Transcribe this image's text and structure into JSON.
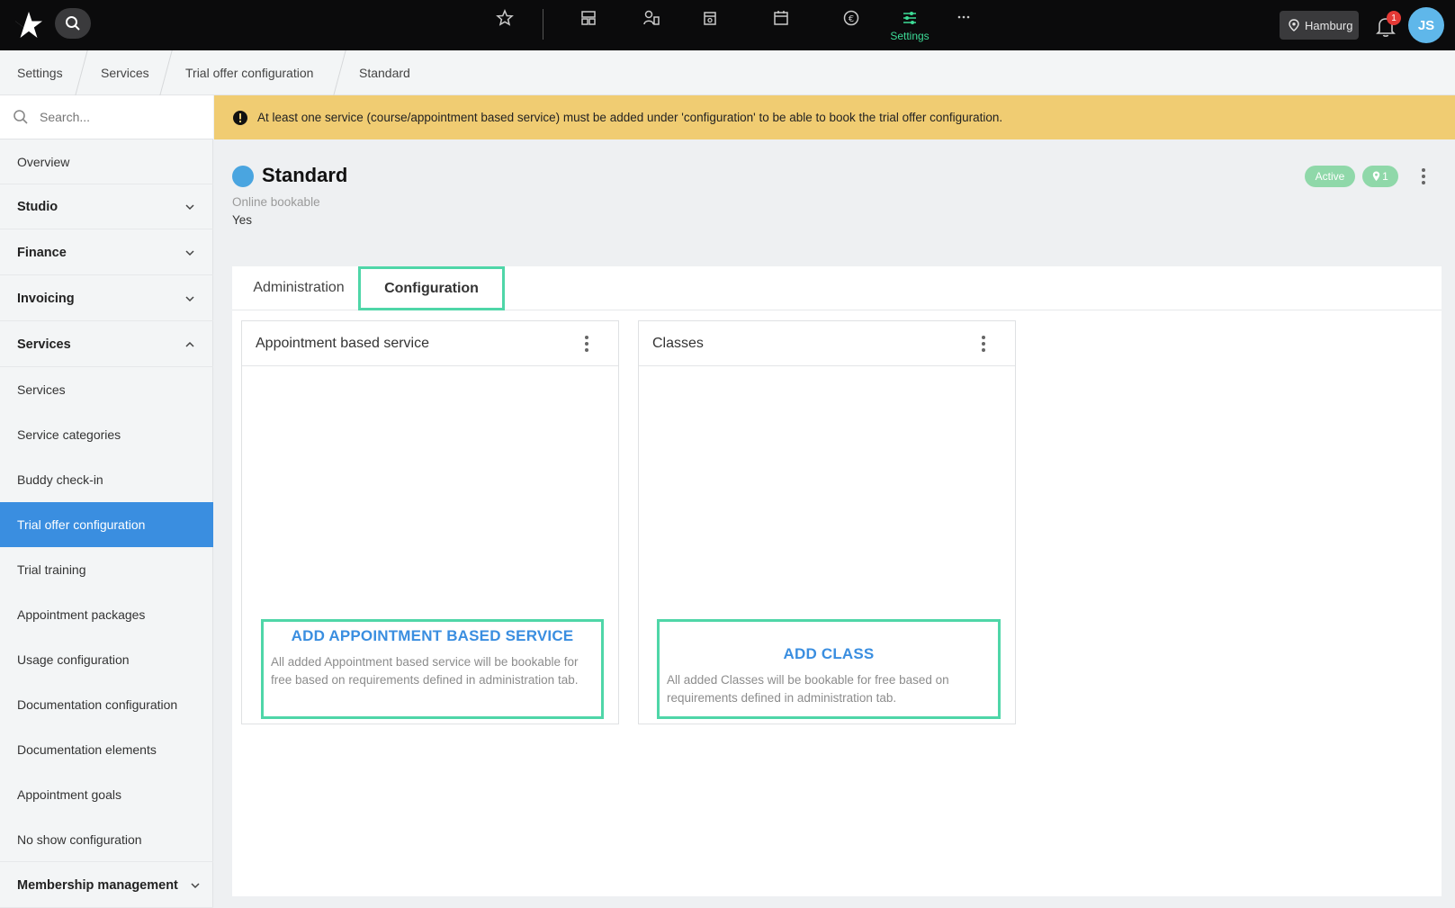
{
  "topbar": {
    "settings_label": "Settings",
    "location": "Hamburg",
    "notification_count": "1",
    "user_initials": "JS"
  },
  "breadcrumb": [
    "Settings",
    "Services",
    "Trial offer configuration",
    "Standard"
  ],
  "sidebar": {
    "search_placeholder": "Search...",
    "items": [
      {
        "label": "Overview"
      },
      {
        "label": "Studio"
      },
      {
        "label": "Finance"
      },
      {
        "label": "Invoicing"
      },
      {
        "label": "Services"
      },
      {
        "label": "Services"
      },
      {
        "label": "Service categories"
      },
      {
        "label": "Buddy check-in"
      },
      {
        "label": "Trial offer configuration"
      },
      {
        "label": "Trial training"
      },
      {
        "label": "Appointment packages"
      },
      {
        "label": "Usage configuration"
      },
      {
        "label": "Documentation configuration"
      },
      {
        "label": "Documentation elements"
      },
      {
        "label": "Appointment goals"
      },
      {
        "label": "No show configuration"
      },
      {
        "label": "Membership management"
      }
    ]
  },
  "banner": {
    "text": "At least one service (course/appointment based service) must be added under 'configuration' to be able to book the trial offer configuration."
  },
  "header": {
    "title": "Standard",
    "meta_label": "Online bookable",
    "meta_value": "Yes",
    "status_badge": "Active",
    "location_count": "1",
    "status_color": "#4aa5e0"
  },
  "tabs": [
    {
      "label": "Administration"
    },
    {
      "label": "Configuration"
    }
  ],
  "cards": [
    {
      "title": "Appointment based service",
      "add_title": "ADD APPOINTMENT BASED SERVICE",
      "add_desc": "All added Appointment based service will be bookable for free based on requirements defined in administration tab."
    },
    {
      "title": "Classes",
      "add_title": "ADD CLASS",
      "add_desc": "All added Classes will be bookable for free based on requirements defined in administration tab."
    }
  ],
  "colors": {
    "accent": "#3a8ee0",
    "highlight": "#4fd6a8",
    "warning": "#f0cc72"
  }
}
